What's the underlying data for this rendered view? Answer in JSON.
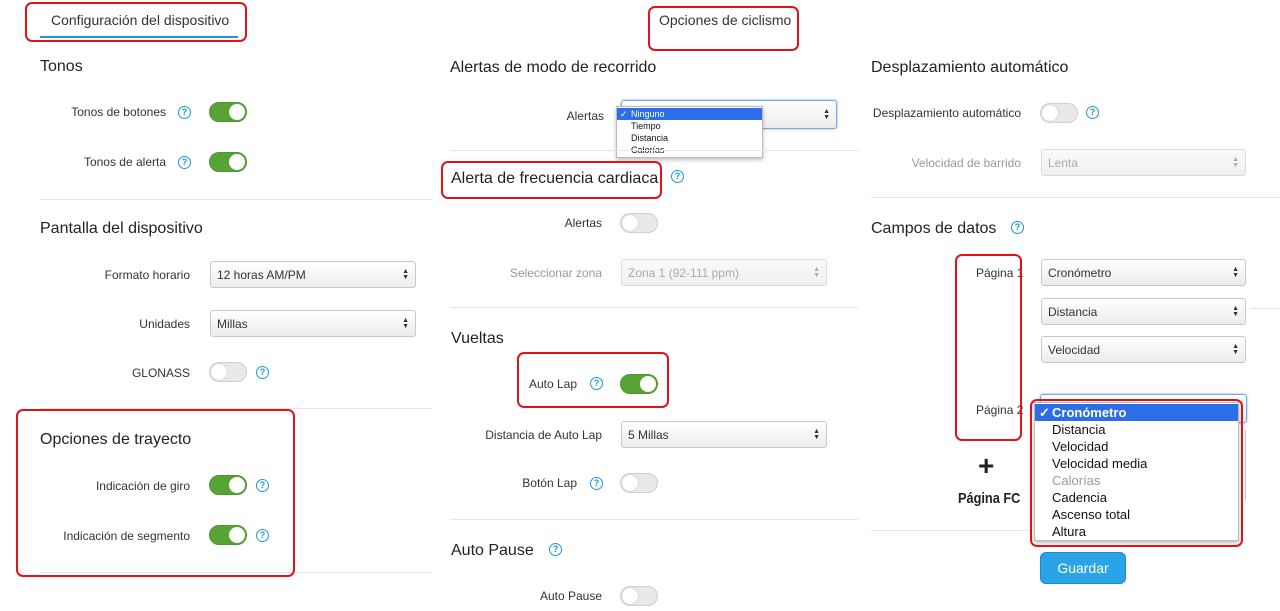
{
  "tabs": {
    "device_settings": "Configuración del dispositivo",
    "cycling_options": "Opciones de ciclismo"
  },
  "col1": {
    "tones": {
      "title": "Tonos",
      "button_tones": "Tonos de botones",
      "alert_tones": "Tonos de alerta"
    },
    "display": {
      "title": "Pantalla del dispositivo",
      "time_format_label": "Formato horario",
      "time_format_value": "12 horas AM/PM",
      "units_label": "Unidades",
      "units_value": "Millas",
      "glonass_label": "GLONASS"
    },
    "route": {
      "title": "Opciones de trayecto",
      "turn_indication": "Indicación de giro",
      "segment_indication": "Indicación de segmento"
    }
  },
  "col2": {
    "ride_alerts": {
      "title": "Alertas de modo de recorrido",
      "alerts_label": "Alertas",
      "options": [
        "Ninguno",
        "Tiempo",
        "Distancia",
        "Calorías"
      ],
      "selected": "Ninguno"
    },
    "hr_alert": {
      "title": "Alerta de frecuencia cardiaca",
      "alerts_label": "Alertas",
      "zone_label": "Seleccionar zona",
      "zone_value": "Zona 1 (92-111 ppm)"
    },
    "laps": {
      "title": "Vueltas",
      "auto_lap_label": "Auto Lap",
      "auto_lap_distance_label": "Distancia de Auto Lap",
      "auto_lap_distance_value": "5 Millas",
      "lap_button_label": "Botón Lap"
    },
    "auto_pause": {
      "title": "Auto Pause",
      "auto_pause_label": "Auto Pause"
    }
  },
  "col3": {
    "auto_scroll": {
      "title": "Desplazamiento automático",
      "toggle_label": "Desplazamiento automático",
      "speed_label": "Velocidad de barrido",
      "speed_value": "Lenta"
    },
    "data_fields": {
      "title": "Campos de datos",
      "page1_label": "Página 1",
      "page1_fields": [
        "Cronómetro",
        "Distancia",
        "Velocidad"
      ],
      "page2_label": "Página 2",
      "page2_options": [
        "Cronómetro",
        "Distancia",
        "Velocidad",
        "Velocidad media",
        "Calorías",
        "Cadencia",
        "Ascenso total",
        "Altura"
      ],
      "page2_selected": "Cronómetro",
      "page2_disabled_option": "Calorías",
      "add_page_symbol": "+",
      "hr_page_label": "Página FC"
    },
    "save_label": "Guardar"
  },
  "colors": {
    "toggle_on": "#58a336",
    "help_icon": "#1a9ad6",
    "annotation": "#e0131a",
    "selection": "#2d6ee8",
    "save_button": "#2aa4e6"
  }
}
